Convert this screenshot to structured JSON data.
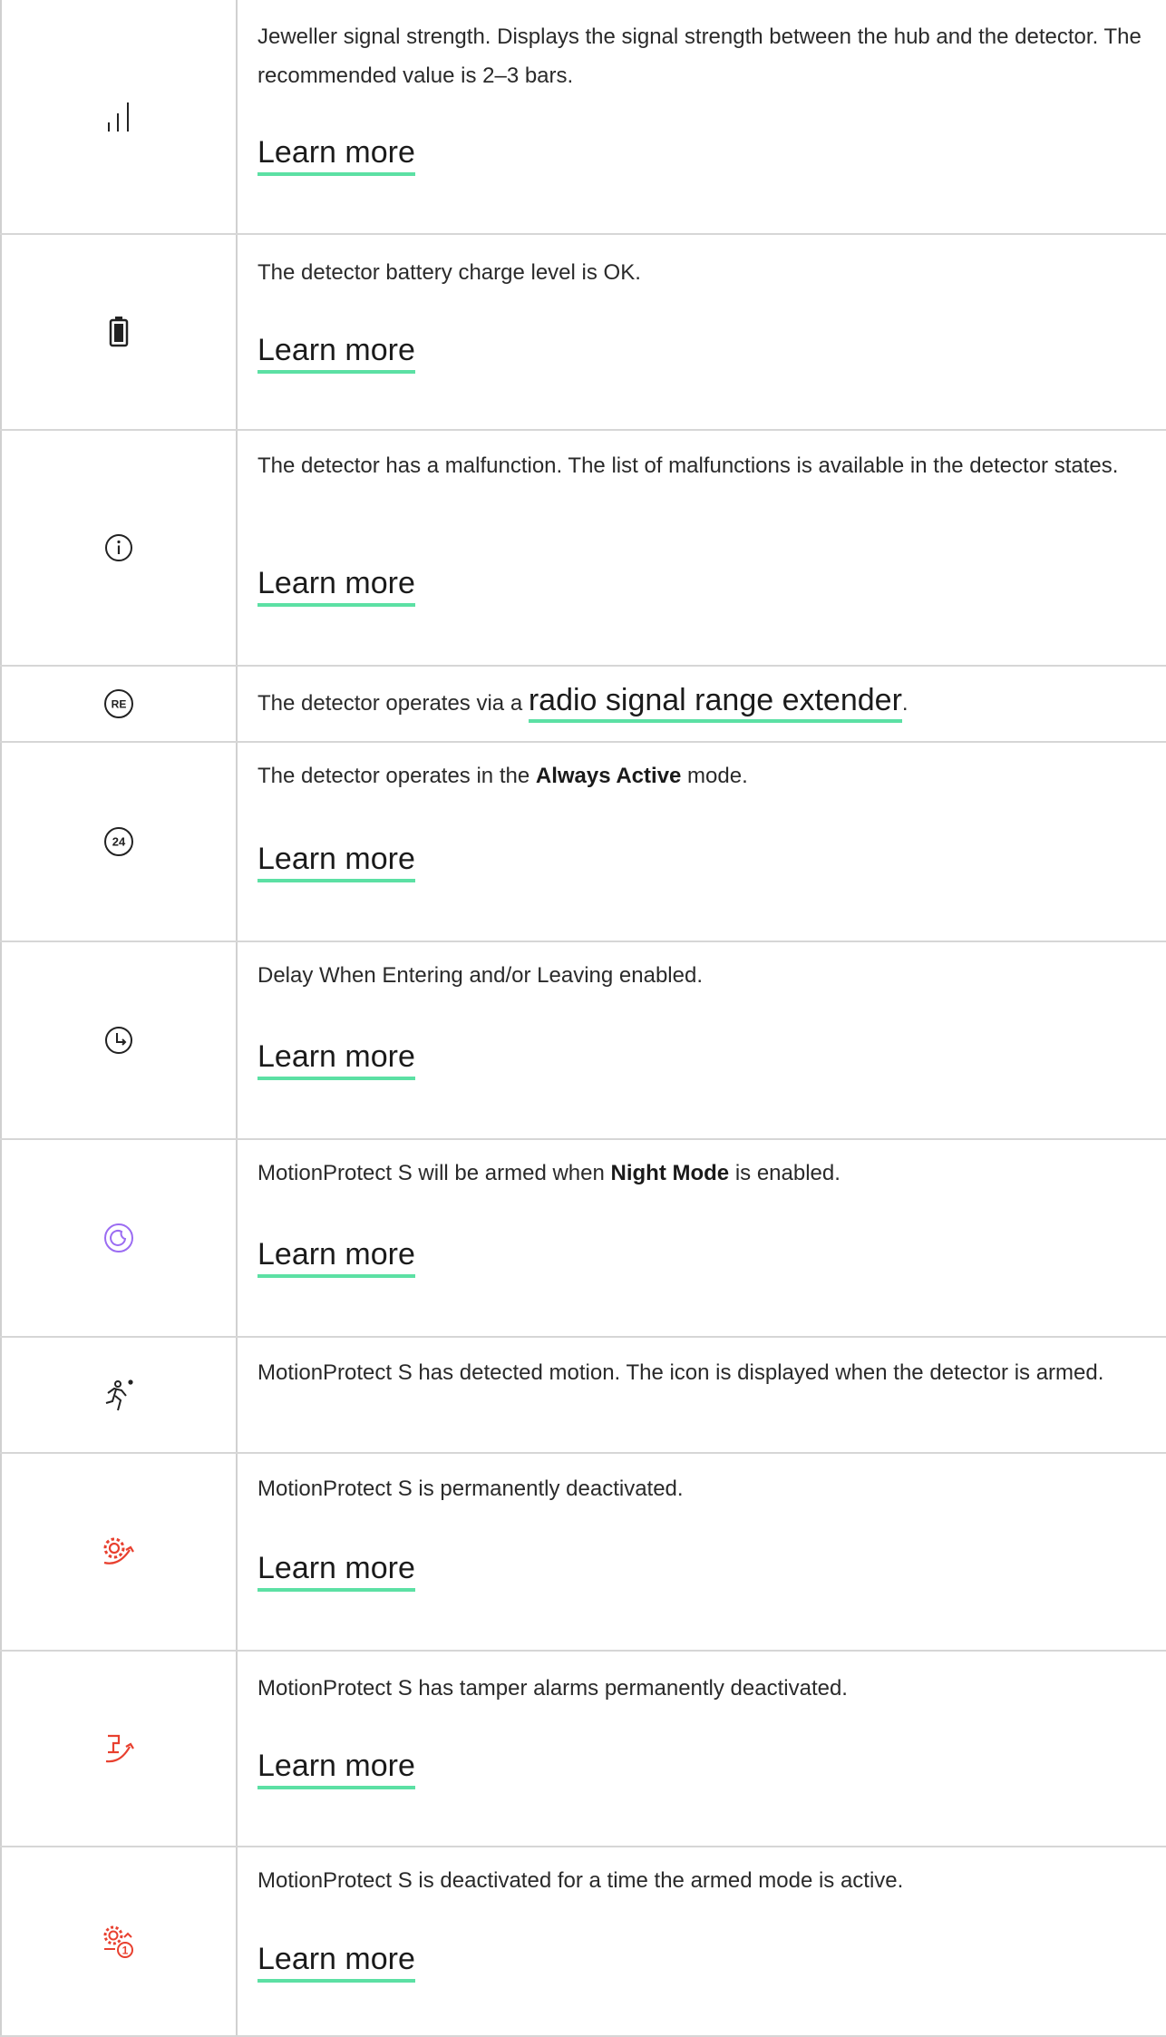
{
  "colors": {
    "icon_default": "#222222",
    "icon_purple": "#9b6cf2",
    "icon_red": "#e8402f",
    "link_underline": "#5ce0a4",
    "border": "#d6d6d6"
  },
  "rows": [
    {
      "icon": "signal-strength-icon",
      "description": "Jeweller signal strength. Displays the signal strength between the hub and the detector. The recommended value is 2–3 bars.",
      "link": "Learn more"
    },
    {
      "icon": "battery-icon",
      "description": "The detector battery charge level is OK.",
      "link": "Learn more"
    },
    {
      "icon": "info-icon",
      "description": "The detector has a malfunction. The list of malfunctions is available in the detector states.",
      "link": "Learn more"
    },
    {
      "icon": "re-icon",
      "icon_text": "RE",
      "description_before": "The detector operates via a ",
      "inline_link": "radio signal range extender",
      "description_after": "."
    },
    {
      "icon": "always-active-24-icon",
      "icon_text": "24",
      "description_before": "The detector operates in the ",
      "bold": "Always Active",
      "description_after": " mode.",
      "link": "Learn more"
    },
    {
      "icon": "delay-clock-icon",
      "description": "Delay When Entering and/or Leaving enabled.",
      "link": "Learn more"
    },
    {
      "icon": "night-mode-icon",
      "description_before": "MotionProtect S will be armed when ",
      "bold": "Night Mode",
      "description_after": " is enabled.",
      "link": "Learn more"
    },
    {
      "icon": "motion-detected-icon",
      "description": "MotionProtect S has detected motion. The icon is displayed when the detector is armed."
    },
    {
      "icon": "permanently-deactivated-icon",
      "description": "MotionProtect S is permanently deactivated.",
      "link": "Learn more"
    },
    {
      "icon": "tamper-deactivated-icon",
      "description": "MotionProtect S has tamper alarms permanently deactivated.",
      "link": "Learn more"
    },
    {
      "icon": "deactivated-once-icon",
      "icon_text": "1",
      "description": "MotionProtect S is deactivated for a time the armed mode is active.",
      "link": "Learn more"
    }
  ]
}
